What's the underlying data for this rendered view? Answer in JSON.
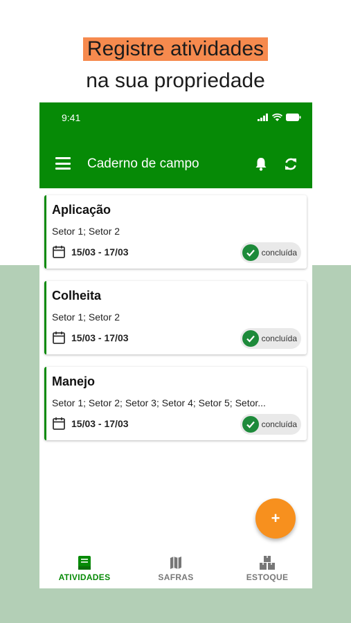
{
  "promo": {
    "line1": "Registre atividades",
    "line2": "na sua propriedade"
  },
  "status_bar": {
    "time": "9:41"
  },
  "toolbar": {
    "title": "Caderno de campo",
    "menu_icon": "menu-icon",
    "bell_icon": "bell-icon",
    "sync_icon": "sync-icon"
  },
  "activities": [
    {
      "title": "Aplicação",
      "sectors": "Setor 1; Setor 2",
      "date": "15/03 - 17/03",
      "status": "concluída"
    },
    {
      "title": "Colheita",
      "sectors": "Setor 1; Setor 2",
      "date": "15/03 - 17/03",
      "status": "concluída"
    },
    {
      "title": "Manejo",
      "sectors": "Setor 1; Setor 2; Setor 3; Setor 4; Setor 5; Setor...",
      "date": "15/03 - 17/03",
      "status": "concluída"
    }
  ],
  "fab": {
    "label": "+"
  },
  "bottom_nav": {
    "items": [
      {
        "label": "ATIVIDADES",
        "icon": "book-icon",
        "active": true
      },
      {
        "label": "SAFRAS",
        "icon": "map-icon",
        "active": false
      },
      {
        "label": "ESTOQUE",
        "icon": "boxes-icon",
        "active": false
      }
    ]
  },
  "colors": {
    "primary_green": "#068a06",
    "accent_orange": "#f7901e",
    "highlight_orange": "#f68a4e",
    "background_green": "#b3cfb6",
    "status_green": "#1d8a3a"
  }
}
